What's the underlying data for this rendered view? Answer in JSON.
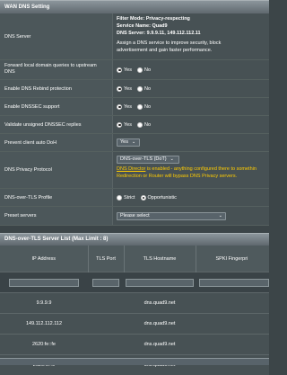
{
  "section_title": "WAN DNS Setting",
  "dns_server": {
    "label": "DNS Server",
    "filter_mode_label": "Filter Mode: ",
    "filter_mode_value": "Privacy-respecting",
    "service_name_label": "Service Name: ",
    "service_name_value": "Quad9",
    "dns_server_label": "DNS Server: ",
    "dns_server_value": "9.9.9.11, 149.112.112.11",
    "description_line1": "Assign a DNS service to improve security, block",
    "description_line2": "advertisement and gain faster performance."
  },
  "forward_queries": {
    "label_line1": "Forward local domain queries to upstream",
    "label_line2": "DNS",
    "yes": "Yes",
    "no": "No",
    "selected": "Yes"
  },
  "rebind": {
    "label": "Enable DNS Rebind protection",
    "yes": "Yes",
    "no": "No",
    "selected": "Yes"
  },
  "dnssec": {
    "label": "Enable DNSSEC support",
    "yes": "Yes",
    "no": "No",
    "selected": "Yes"
  },
  "validate_unsigned": {
    "label": "Validate unsigned DNSSEC replies",
    "yes": "Yes",
    "no": "No",
    "selected": "Yes"
  },
  "prevent_doh": {
    "label": "Prevent client auto DoH",
    "value": "Yes"
  },
  "privacy_protocol": {
    "label": "DNS Privacy Protocol",
    "value": "DNS-over-TLS (DoT)",
    "warning_link": "DNS Director",
    "warning_rest1": " is enabled - anything configured there to somethin",
    "warning_line2": "Redirection or Router will bypass DNS Privacy servers."
  },
  "dot_profile": {
    "label": "DNS-over-TLS Profile",
    "strict": "Strict",
    "opportunistic": "Opportunistic",
    "selected": "Opportunistic"
  },
  "preset_servers": {
    "label": "Preset servers",
    "value": "Please select"
  },
  "server_list_title": "DNS-over-TLS Server List (Max Limit : 8)",
  "columns": [
    "IP Address",
    "TLS Port",
    "TLS Hostname",
    "SPKI Fingerpri"
  ],
  "servers": [
    {
      "ip": "9.9.9.9",
      "port": "",
      "hostname": "dns.quad9.net"
    },
    {
      "ip": "149.112.112.112",
      "port": "",
      "hostname": "dns.quad9.net"
    },
    {
      "ip": "2620:fe::fe",
      "port": "",
      "hostname": "dns.quad9.net"
    },
    {
      "ip": "2620:fe::9",
      "port": "",
      "hostname": "dns.quad9.net"
    }
  ]
}
